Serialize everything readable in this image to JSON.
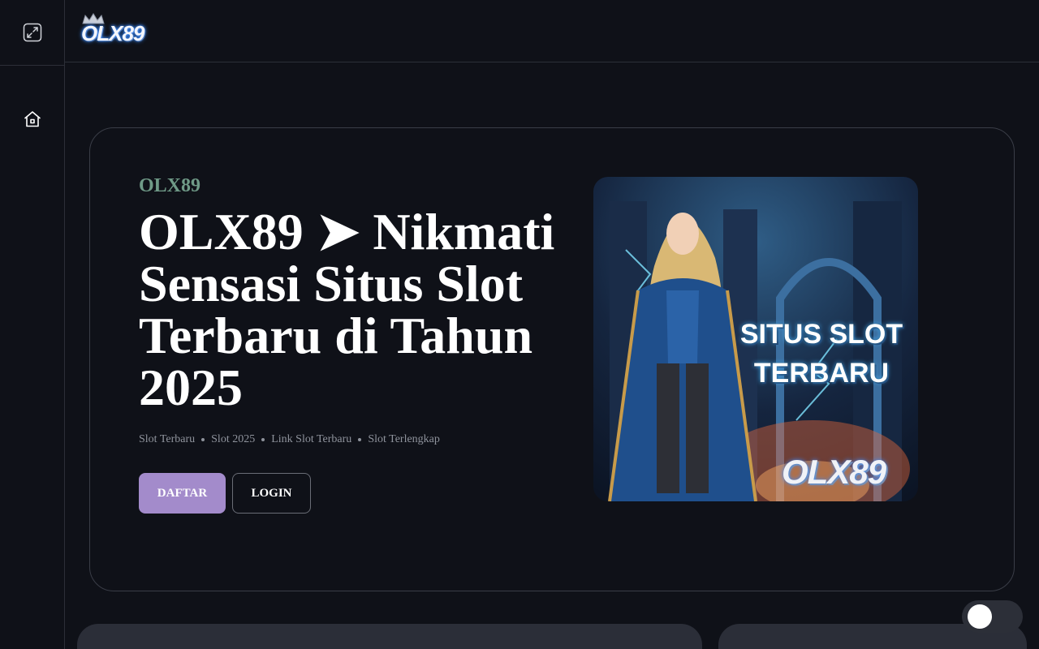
{
  "brand": {
    "logo_text": "OLX89"
  },
  "sidebar": {
    "expand_icon": "expand-icon",
    "items": [
      {
        "icon": "home-icon"
      }
    ]
  },
  "hero": {
    "eyebrow": "OLX89",
    "headline": "OLX89 ➤ Nikmati Sensasi Situs Slot Terbaru di Tahun 2025",
    "tags": [
      "Slot Terbaru",
      "Slot 2025",
      "Link Slot Terbaru",
      "Slot Terlengkap"
    ],
    "primary_button": "DAFTAR",
    "secondary_button": "LOGIN",
    "image": {
      "caption_line1": "SITUS SLOT",
      "caption_line2": "TERBARU",
      "logo_text": "OLX89"
    }
  },
  "colors": {
    "background": "#0f1118",
    "accent": "#a38bcb",
    "eyebrow": "#6f9a87",
    "card": "#2b2e38"
  },
  "theme_toggle": {
    "state": "off"
  }
}
